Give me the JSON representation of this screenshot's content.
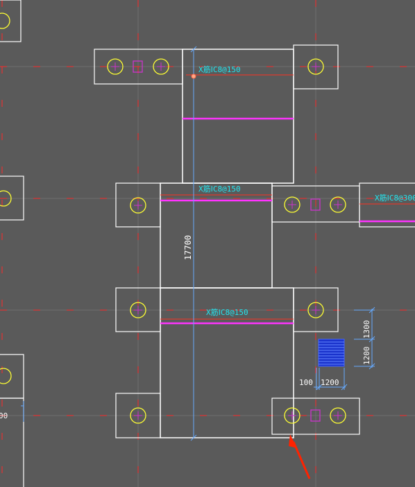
{
  "drawing": {
    "background": "#5a5a5a",
    "colors": {
      "outline": "#ffffff",
      "pile": "#ffff33",
      "column": "#cc33cc",
      "rebar_text": "#22e6f0",
      "magenta_bar": "#ff33ff",
      "red_bar": "#ff3322",
      "axis": "#ff2a2a",
      "grid": "#6e6e6e",
      "hatch": "#2244ff",
      "dim_line": "#66aaff",
      "arrow": "#ff2200"
    },
    "labels": {
      "rebar_1": "X筋ⅠC8@150",
      "rebar_2": "X筋ⅠC8@150",
      "rebar_3": "X筋ⅠC8@150",
      "rebar_4": "X筋ⅠC8@300"
    },
    "dimensions": {
      "total_length": "17700",
      "dim_1300": "1300",
      "dim_1200_v": "1200",
      "dim_100": "100",
      "dim_1200_h": "1200",
      "dim_left_partial": "00"
    }
  }
}
